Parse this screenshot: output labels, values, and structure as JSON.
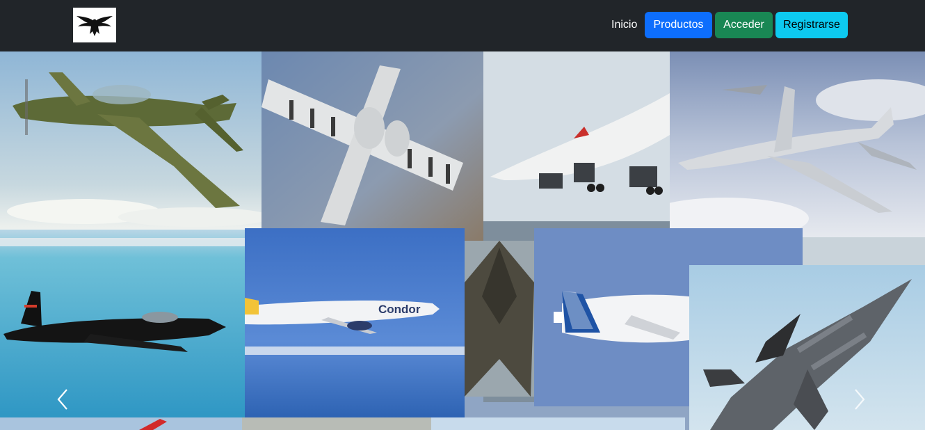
{
  "navbar": {
    "logo_icon": "eagle-logo-icon",
    "links": {
      "home": "Inicio"
    },
    "buttons": {
      "products": {
        "label": "Productos",
        "bg": "#0d6efd",
        "color": "#ffffff"
      },
      "login": {
        "label": "Acceder",
        "bg": "#198754",
        "color": "#ffffff"
      },
      "register": {
        "label": "Registrarse",
        "bg": "#0dcaf0",
        "color": "#000000"
      }
    }
  },
  "carousel": {
    "prev_icon": "chevron-left-icon",
    "next_icon": "chevron-right-icon",
    "photos": {
      "condor_livery": "Condor"
    }
  },
  "colors": {
    "navbar_bg": "#212529"
  }
}
